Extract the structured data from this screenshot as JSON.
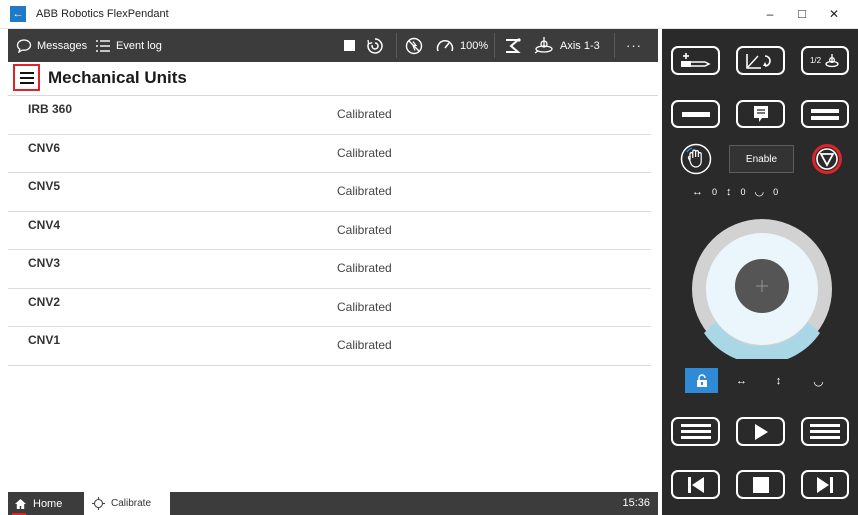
{
  "window": {
    "back_glyph": "←",
    "title": "ABB Robotics FlexPendant",
    "minimize": "–",
    "maximize": "□",
    "close": "✕"
  },
  "toolbar": {
    "messages_label": "Messages",
    "event_log_label": "Event log",
    "speed_label": "100%",
    "axis_label": "Axis 1-3",
    "more_label": "···"
  },
  "page": {
    "title": "Mechanical Units"
  },
  "units": [
    {
      "name": "IRB 360",
      "status": "Calibrated"
    },
    {
      "name": "CNV6",
      "status": "Calibrated"
    },
    {
      "name": "CNV5",
      "status": "Calibrated"
    },
    {
      "name": "CNV4",
      "status": "Calibrated"
    },
    {
      "name": "CNV3",
      "status": "Calibrated"
    },
    {
      "name": "CNV2",
      "status": "Calibrated"
    },
    {
      "name": "CNV1",
      "status": "Calibrated"
    }
  ],
  "taskbar": {
    "home_label": "Home",
    "calibrate_label": "Calibrate",
    "time": "15:36"
  },
  "panel": {
    "enable_label": "Enable",
    "axis_readout": [
      "0",
      "0",
      "0"
    ],
    "fraction_label": "1/2",
    "accent_color": "#2f8bd6",
    "stop_color": "#e0232a",
    "joystick_arc_color": "#a9d7e6"
  }
}
